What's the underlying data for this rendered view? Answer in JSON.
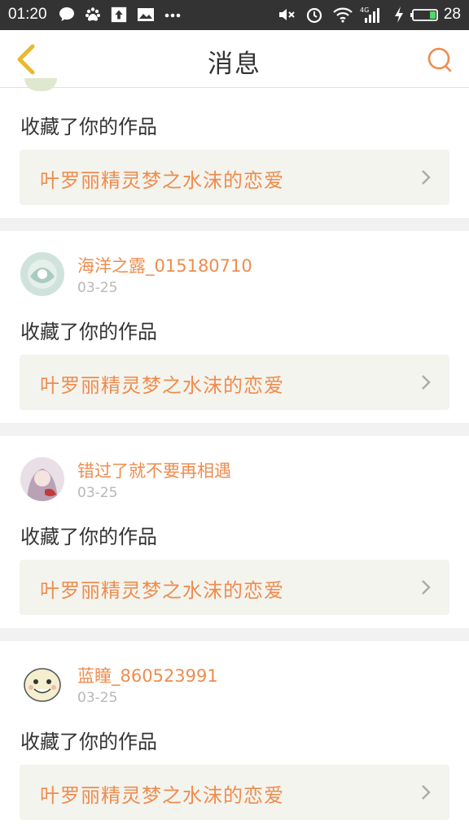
{
  "status_bar": {
    "time": "01:20",
    "battery": "28",
    "icons": [
      "chat-icon",
      "paw-icon",
      "upload-icon",
      "picture-icon",
      "more-dots-icon",
      "mute-icon",
      "alarm-icon",
      "wifi-icon",
      "signal-4g-icon",
      "charging-icon",
      "battery-icon"
    ]
  },
  "header": {
    "title": "消息"
  },
  "messages": [
    {
      "partial": true,
      "action": "收藏了你的作品",
      "work": "叶罗丽精灵梦之水沫的恋爱"
    },
    {
      "username": "海洋之露_015180710",
      "date": "03-25",
      "action": "收藏了你的作品",
      "work": "叶罗丽精灵梦之水沫的恋爱"
    },
    {
      "username": "错过了就不要再相遇",
      "date": "03-25",
      "action": "收藏了你的作品",
      "work": "叶罗丽精灵梦之水沫的恋爱"
    },
    {
      "username": "蓝瞳_860523991",
      "date": "03-25",
      "action": "收藏了你的作品",
      "work": "叶罗丽精灵梦之水沫的恋爱"
    }
  ],
  "colors": {
    "accent": "#ef8c4e",
    "back_arrow": "#e8b830",
    "status_bar": "#333333",
    "work_box": "#f4f4ee"
  }
}
